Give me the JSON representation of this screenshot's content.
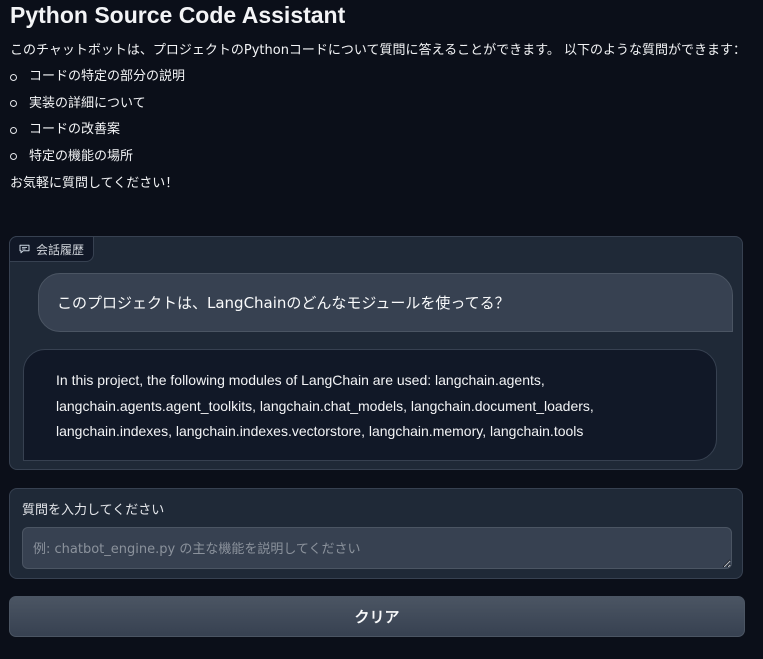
{
  "app": {
    "title": "Python Source Code Assistant"
  },
  "intro": {
    "description": "このチャットボットは、プロジェクトのPythonコードについて質問に答えることができます。 以下のような質問ができます：",
    "items": [
      "コードの特定の部分の説明",
      "実装の詳細について",
      "コードの改善案",
      "特定の機能の場所"
    ],
    "closing": "お気軽に質問してください！"
  },
  "chat": {
    "label": "会話履歴",
    "label_icon": "chat-bubble-icon",
    "messages": [
      {
        "role": "user",
        "text": "このプロジェクトは、LangChainのどんなモジュールを使ってる？"
      },
      {
        "role": "assistant",
        "text": "In this project, the following modules of LangChain are used: langchain.agents, langchain.agents.agent_toolkits, langchain.chat_models, langchain.document_loaders, langchain.indexes, langchain.indexes.vectorstore, langchain.memory, langchain.tools"
      }
    ]
  },
  "input": {
    "label": "質問を入力してください",
    "value": "",
    "placeholder": "例: chatbot_engine.py の主な機能を説明してください"
  },
  "actions": {
    "clear_label": "クリア"
  },
  "colors": {
    "background": "#0b0f19",
    "panel": "#1f2937",
    "border": "#374151",
    "user_bubble": "#374151",
    "bot_bubble": "#111827",
    "button": "#4b5563"
  }
}
